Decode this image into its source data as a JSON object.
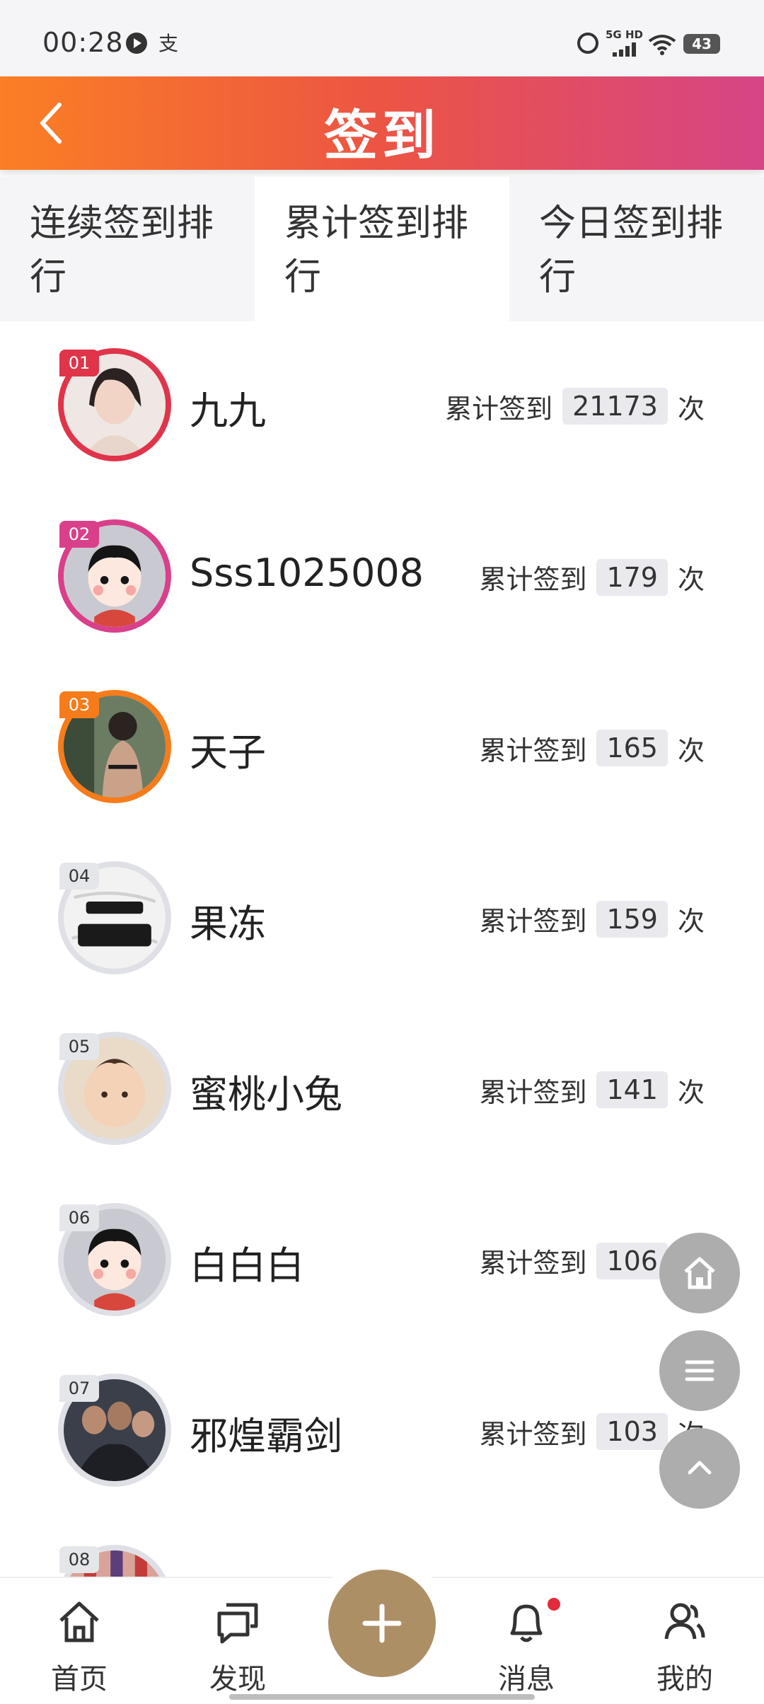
{
  "status_bar": {
    "time": "00:28",
    "pay_glyph": "支",
    "network": "5G HD",
    "battery": "43",
    "icons": [
      "play-icon",
      "pay-icon",
      "alarm-icon",
      "signal-icon",
      "wifi-icon",
      "battery-icon"
    ]
  },
  "header": {
    "title": "签到",
    "back_icon": "chevron-left-icon",
    "gradient": [
      "#fb7f24",
      "#ec5444",
      "#d64586"
    ]
  },
  "tabs": [
    {
      "label": "连续签到排行",
      "active": false
    },
    {
      "label": "累计签到排行",
      "active": true
    },
    {
      "label": "今日签到排行",
      "active": false
    }
  ],
  "ranking": {
    "stat_label": "累计签到",
    "stat_unit": "次",
    "rows": [
      {
        "rank": "01",
        "name": "九九",
        "count": "21173"
      },
      {
        "rank": "02",
        "name": "Sss1025008",
        "count": "179"
      },
      {
        "rank": "03",
        "name": "天子",
        "count": "165"
      },
      {
        "rank": "04",
        "name": "果冻",
        "count": "159"
      },
      {
        "rank": "05",
        "name": "蜜桃小兔",
        "count": "141"
      },
      {
        "rank": "06",
        "name": "白白白",
        "count": "106"
      },
      {
        "rank": "07",
        "name": "邪煌霸剑",
        "count": "103"
      },
      {
        "rank": "08",
        "name": "",
        "count": ""
      }
    ],
    "top_colors": [
      "#e0344a",
      "#d93f8a",
      "#f67b1a"
    ]
  },
  "floating_buttons": [
    "home-icon",
    "menu-icon",
    "chevron-up-icon"
  ],
  "bottom_nav": {
    "items": [
      {
        "label": "首页",
        "icon": "home-icon"
      },
      {
        "label": "发现",
        "icon": "chat-icon"
      },
      {
        "label": "消息",
        "icon": "bell-icon"
      },
      {
        "label": "我的",
        "icon": "user-icon"
      }
    ],
    "add_button_icon": "plus-icon",
    "accent": "#ad8f66"
  }
}
